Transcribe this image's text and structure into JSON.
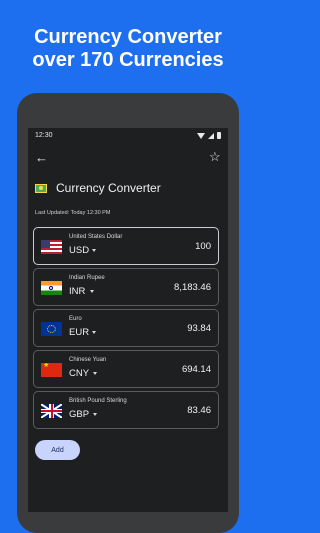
{
  "promo": {
    "line1": "Currency Converter",
    "line2": "over 170 Currencies"
  },
  "status_bar": {
    "time": "12:30"
  },
  "app": {
    "title": "Currency Converter",
    "last_updated": "Last Updated: Today 12:30 PM",
    "add_label": "Add"
  },
  "currencies": [
    {
      "name": "United States Dollar",
      "code": "USD",
      "amount": "100",
      "flag": "us-flag-icon",
      "selected": true
    },
    {
      "name": "Indian Rupee",
      "code": "INR",
      "amount": "8,183.46",
      "flag": "india-flag-icon"
    },
    {
      "name": "Euro",
      "code": "EUR",
      "amount": "93.84",
      "flag": "eu-flag-icon"
    },
    {
      "name": "Chinese Yuan",
      "code": "CNY",
      "amount": "694.14",
      "flag": "china-flag-icon"
    },
    {
      "name": "British Pound Sterling",
      "code": "GBP",
      "amount": "83.46",
      "flag": "uk-flag-icon"
    }
  ],
  "icons": {
    "back": "arrow-back-icon",
    "favorite": "star-outline-icon",
    "app": "money-bill-icon"
  },
  "colors": {
    "background": "#1e6ff0",
    "screen": "#1e1f21",
    "add_button": "#c8d4fb"
  }
}
